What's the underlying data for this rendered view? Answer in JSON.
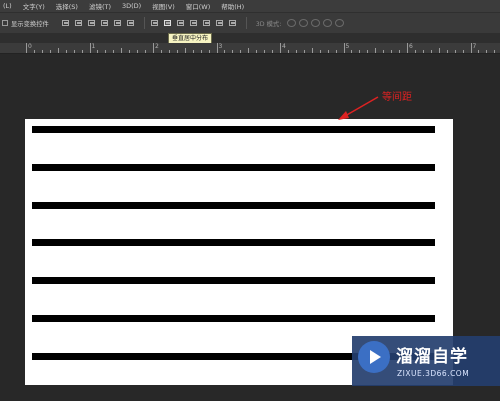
{
  "menubar": {
    "items": [
      "(L)",
      "文字(Y)",
      "选择(S)",
      "滤镜(T)",
      "3D(D)",
      "视图(V)",
      "窗口(W)",
      "帮助(H)"
    ]
  },
  "options": {
    "show_transform_controls": "显示变换控件",
    "mode_3d": "3D 模式:"
  },
  "tooltip": {
    "text": "垂直居中分布"
  },
  "ruler": {
    "labels": [
      "0",
      "1",
      "2",
      "3",
      "4",
      "5",
      "6",
      "7"
    ]
  },
  "annotation": {
    "text": "等间距",
    "color": "#dd2222"
  },
  "document": {
    "line_count": 7
  },
  "watermark": {
    "title": "溜溜自学",
    "url": "ZIXUE.3D66.COM"
  }
}
